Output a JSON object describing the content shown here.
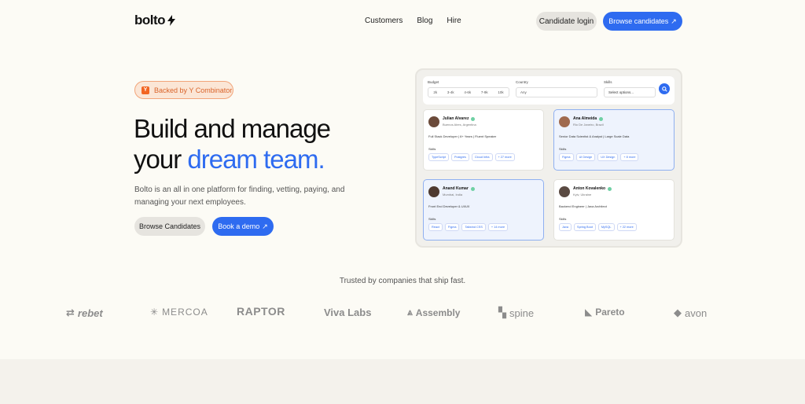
{
  "nav": {
    "logo": "bolto",
    "links": [
      "Customers",
      "Blog",
      "Hire"
    ],
    "login": "Candidate login",
    "browse": "Browse candidates"
  },
  "hero": {
    "badge": "Backed by Y Combinator",
    "badge_icon": "Y",
    "headline_line1": "Build and manage",
    "headline_line2_a": "your ",
    "headline_line2_b": "dream team.",
    "subtext": "Bolto is an all in one platform for finding, vetting, paying, and managing your next employees.",
    "btn_candidates": "Browse Candidates",
    "btn_demo": "Book a demo"
  },
  "panel": {
    "filters": {
      "budget_label": "Budget",
      "budget_options": [
        "2k",
        "3-4k",
        "4-6k",
        "7-9k",
        "10k"
      ],
      "country_label": "Country",
      "country_value": "Any",
      "skills_label": "Skills",
      "skills_placeholder": "Select options..."
    },
    "cards": [
      {
        "name": "Julian Alvarez",
        "location": "Buenos Aires, Argentina",
        "role": "Full Stack Developer  |  6+ Years  |  Fluent Speaker",
        "skills_label": "Skills",
        "skills": [
          "TypeScript",
          "Postgres",
          "Cloud Infra",
          "+ 27 more"
        ]
      },
      {
        "name": "Ana Almeida",
        "location": "Rio De Janeiro, Brazil",
        "role": "Senior Data Scientist & Analyst  |  Large Scale Data",
        "skills_label": "Skills",
        "skills": [
          "Figma",
          "UI Design",
          "UX Design",
          "+ 8 more"
        ]
      },
      {
        "name": "Anand Kumar",
        "location": "Mumbai, India",
        "role": "Front End Developer & UI/UX",
        "skills_label": "Skills",
        "skills": [
          "React",
          "Figma",
          "Tailwind CSS",
          "+ 14 more"
        ]
      },
      {
        "name": "Anton Kovalenko",
        "location": "Kyiv, Ukraine",
        "role": "Backend Engineer  |  Java Architect",
        "skills_label": "Skills",
        "skills": [
          "Java",
          "Spring Boot",
          "MySQL",
          "+ 22 more"
        ]
      }
    ]
  },
  "trusted": {
    "title": "Trusted by companies that ship fast.",
    "logos": [
      "rebet",
      "MERCOA",
      "RAPTOR",
      "Viva Labs",
      "Assembly",
      "spine",
      "Pareto",
      "avon"
    ]
  }
}
